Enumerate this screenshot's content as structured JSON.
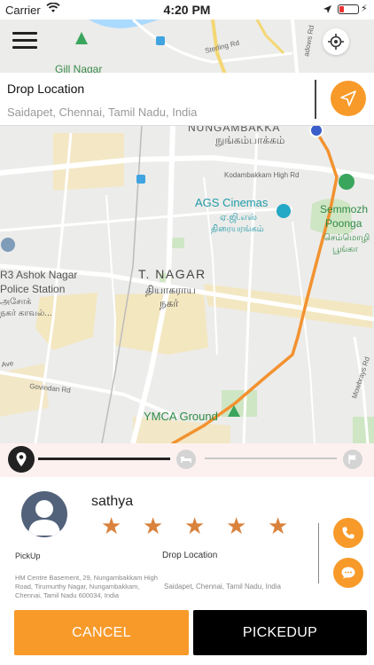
{
  "status_bar": {
    "carrier": "Carrier",
    "time": "4:20 PM"
  },
  "map": {
    "labels": {
      "gill_nagar": "Gill Nagar",
      "sterling_rd": "Sterling Rd",
      "meadows_rd": "adows Rd",
      "nungambakkam_en": "NUNGAMBAKKA",
      "nungambakkam_ta": "நுங்கம்பாக்கம்",
      "kodambakkam_high_rd": "Kodambakkam High Rd",
      "ags_cinemas_en": "AGS Cinemas",
      "ags_cinemas_ta1": "ஏ.ஜி.எஸ்",
      "ags_cinemas_ta2": "திரையரங்கம்",
      "semmozhi_en1": "Semmozh",
      "semmozhi_en2": "Poonga",
      "semmozhi_ta1": "செம்மொழி",
      "semmozhi_ta2": "பூங்கா",
      "t_nagar_en": "T. NAGAR",
      "t_nagar_ta1": "தியாகராய",
      "t_nagar_ta2": "நகர்",
      "ashok_1": "R3 Ashok Nagar",
      "ashok_2": "Police Station",
      "ashok_3": "அசோக்",
      "ashok_4": "நகர் காவல்...",
      "ave": "Ave",
      "govindan_rd": "Govindan Rd",
      "ymca": "YMCA Ground",
      "mowbrays_rd": "Mowbrays Rd"
    }
  },
  "drop": {
    "title": "Drop Location",
    "address": "Saidapet, Chennai, Tamil Nadu, India"
  },
  "progress": {
    "stage": "picked-up-pending"
  },
  "driver": {
    "name": "sathya",
    "rating": 5,
    "stars": [
      "★",
      "★",
      "★",
      "★",
      "★"
    ]
  },
  "trip": {
    "pickup_label": "PickUp",
    "pickup_address": "HM Centre Basement, 29, Nungambakkam High Road, Tirumurthy Nagar, Nungambakkam, Chennai, Tamil Nadu 600034, India",
    "drop_label": "Drop Location",
    "drop_address": "Saidapet, Chennai, Tamil Nadu, India"
  },
  "actions": {
    "cancel_label": "CANCEL",
    "pickedup_label": "PICKEDUP"
  },
  "colors": {
    "accent": "#f79a2a",
    "route": "#f29230",
    "star": "#d9823c",
    "dark": "#000000"
  },
  "icons": {
    "menu": "hamburger-icon",
    "gps": "crosshair-icon",
    "send": "navigation-arrow-icon",
    "pin": "location-pin-icon",
    "bed": "bed-icon",
    "flag": "flag-icon",
    "call": "phone-icon",
    "chat": "chat-bubble-icon"
  }
}
